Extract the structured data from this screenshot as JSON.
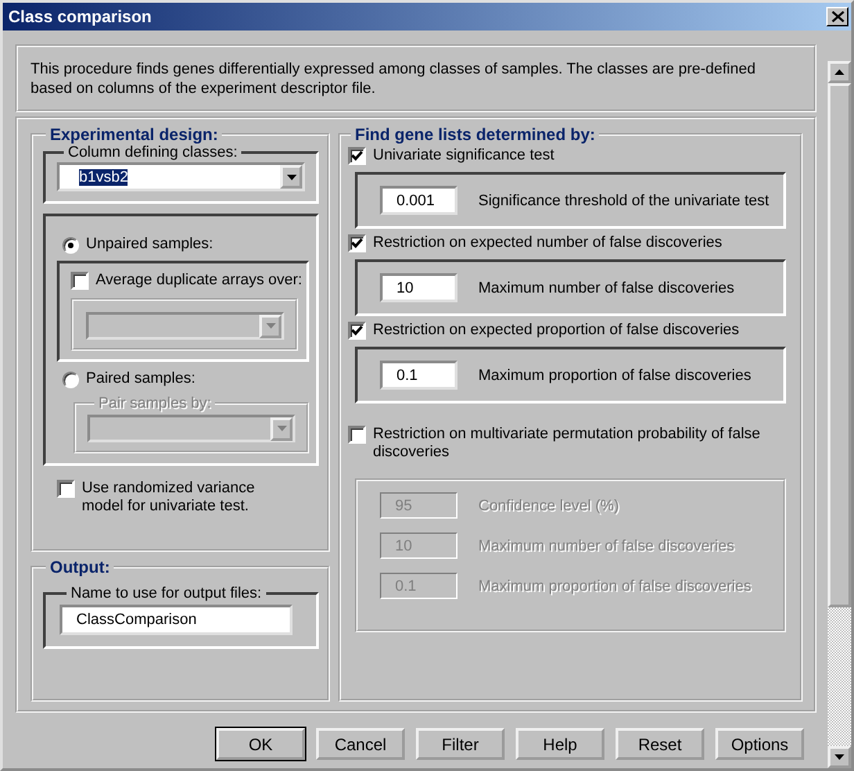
{
  "window": {
    "title": "Class comparison"
  },
  "description": "This procedure finds genes differentially expressed among classes of samples. The classes are pre-defined based on columns of the experiment descriptor file.",
  "experimental_design": {
    "title": "Experimental design:",
    "column_group": {
      "label": "Column defining classes:",
      "value": "b1vsb2"
    },
    "sample_options": [
      {
        "label": "Unpaired samples:",
        "selected": true,
        "kind": "checkbox-group",
        "checkbox": {
          "label": "Average duplicate arrays over:",
          "checked": false
        }
      },
      {
        "label": "Paired samples:",
        "selected": false,
        "kind": "labeled-group",
        "group_label": "Pair samples by:"
      }
    ],
    "randomized_variance": {
      "label": "Use randomized variance model for univariate test.",
      "checked": false
    }
  },
  "output": {
    "title": "Output:",
    "field_label": "Name to use for output files:",
    "value": "ClassComparison"
  },
  "gene_lists": {
    "title": "Find gene lists determined by:",
    "criteria": [
      {
        "label": "Univariate significance test",
        "checked": true,
        "fields": [
          {
            "value": "0.001",
            "label": "Significance threshold of the univariate test"
          }
        ]
      },
      {
        "label": "Restriction on expected number of false discoveries",
        "checked": true,
        "fields": [
          {
            "value": "10",
            "label": "Maximum number of false discoveries"
          }
        ]
      },
      {
        "label": "Restriction on expected proportion of false discoveries",
        "checked": true,
        "fields": [
          {
            "value": "0.1",
            "label": "Maximum proportion of false discoveries"
          }
        ]
      },
      {
        "label": "Restriction on multivariate permutation probability of false discoveries",
        "checked": false,
        "fields": [
          {
            "value": "95",
            "label": "Confidence level (%)"
          },
          {
            "value": "10",
            "label": "Maximum number of false discoveries"
          },
          {
            "value": "0.1",
            "label": "Maximum proportion of false discoveries"
          }
        ]
      }
    ]
  },
  "buttons": [
    {
      "label": "OK",
      "default": true
    },
    {
      "label": "Cancel",
      "default": false
    },
    {
      "label": "Filter",
      "default": false
    },
    {
      "label": "Help",
      "default": false
    },
    {
      "label": "Reset",
      "default": false
    },
    {
      "label": "Options",
      "default": false
    }
  ]
}
